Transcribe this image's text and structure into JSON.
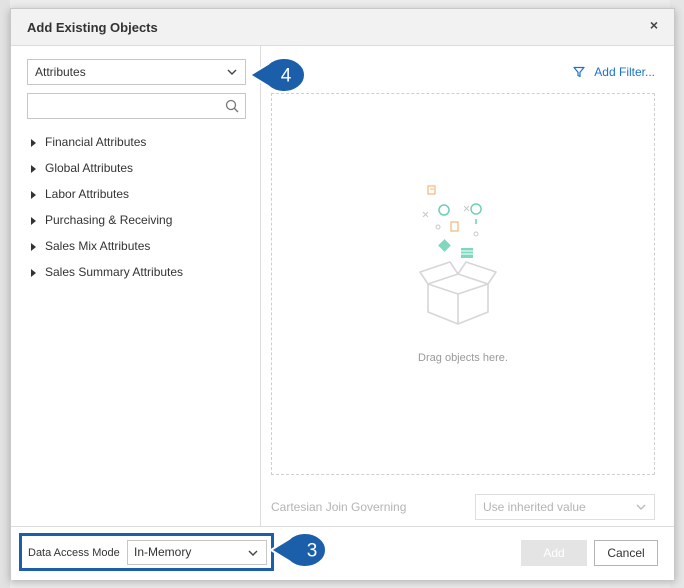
{
  "dialog": {
    "title": "Add Existing Objects",
    "close_glyph": "×"
  },
  "left_pane": {
    "type_select_value": "Attributes",
    "search_placeholder": "",
    "tree_items": [
      "Financial Attributes",
      "Global Attributes",
      "Labor Attributes",
      "Purchasing & Receiving",
      "Sales Mix Attributes",
      "Sales Summary Attributes"
    ]
  },
  "right_pane": {
    "add_filter_label": "Add Filter...",
    "drop_zone_text": "Drag objects here.",
    "cartesian_label": "Cartesian Join Governing",
    "inherit_select_value": "Use inherited value"
  },
  "footer": {
    "data_access_mode_label": "Data Access Mode",
    "data_access_mode_value": "In-Memory",
    "add_label": "Add",
    "cancel_label": "Cancel"
  },
  "callouts": {
    "step_4": "4",
    "step_3": "3"
  },
  "colors": {
    "accent_blue": "#1a73c8",
    "callout_blue": "#1b5faa",
    "highlight_border": "#1b5faa"
  },
  "icons": [
    "close-icon",
    "chevron-down-icon",
    "search-icon",
    "caret-right-icon",
    "filter-icon",
    "drop-illustration-icon"
  ]
}
